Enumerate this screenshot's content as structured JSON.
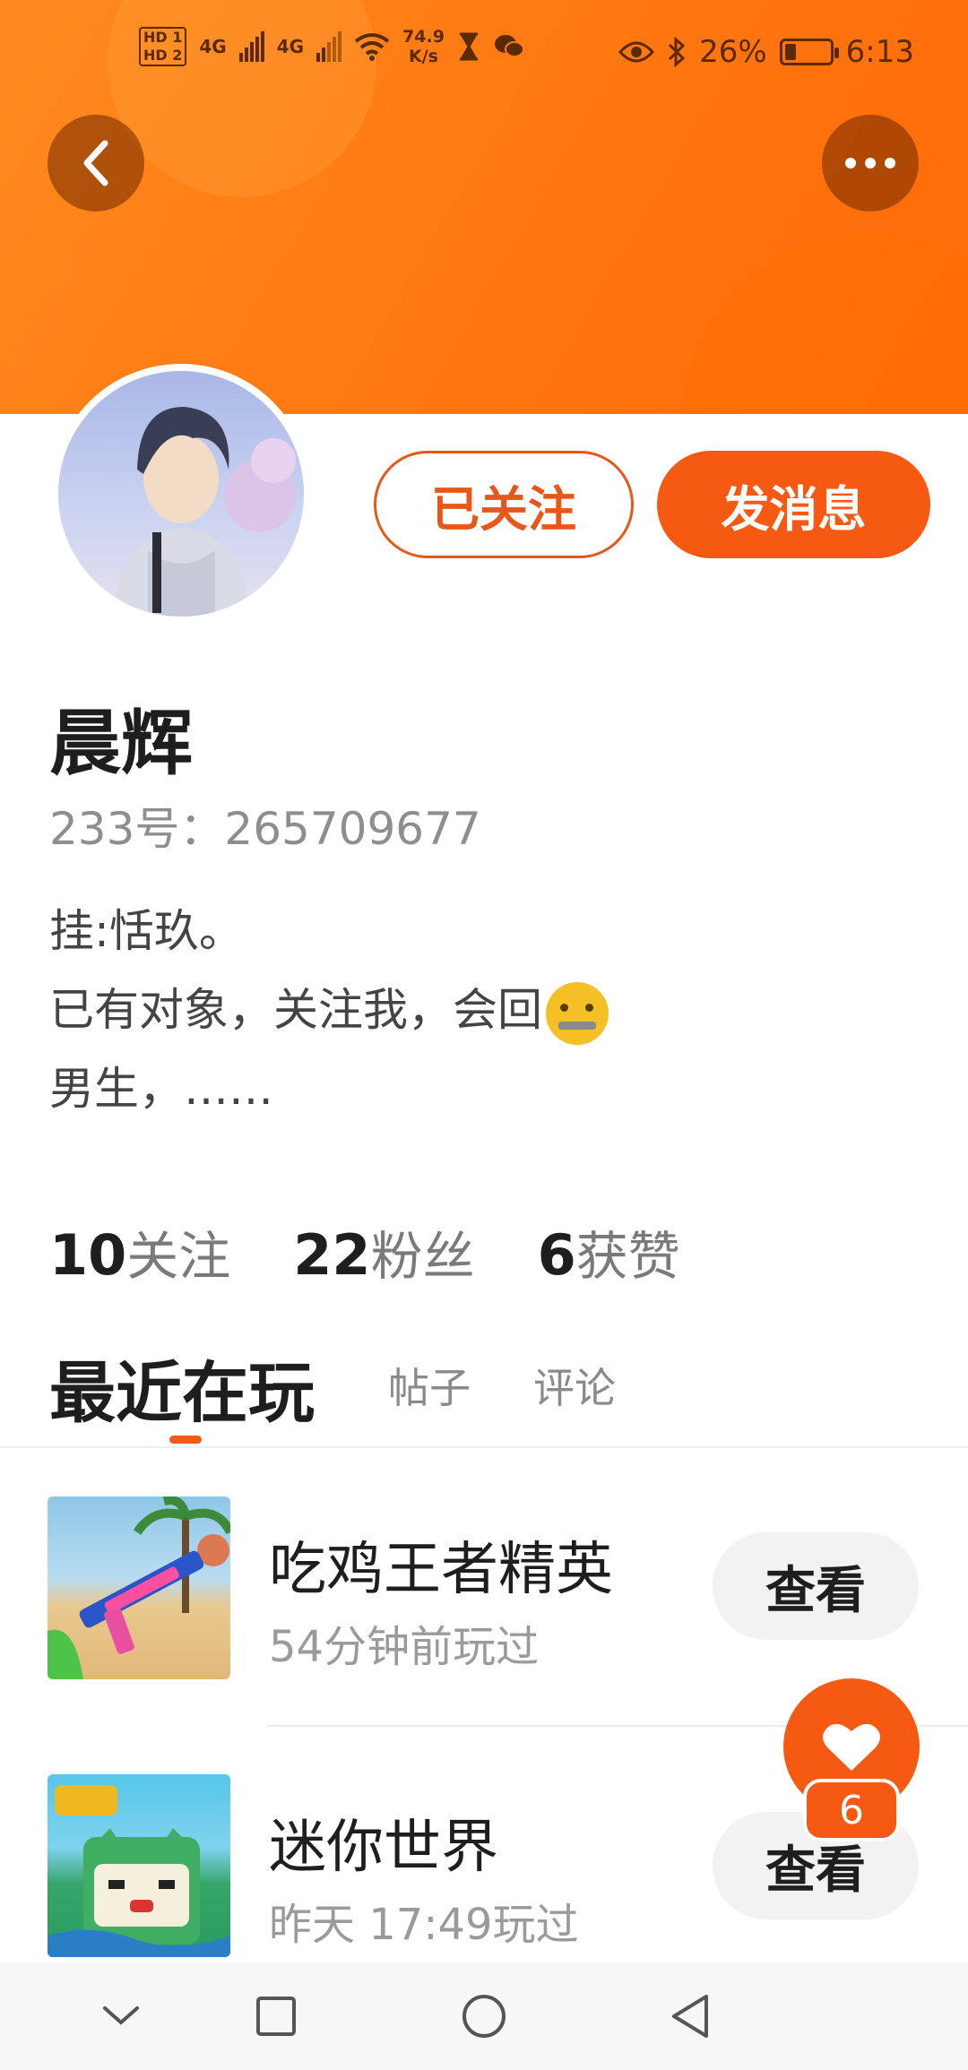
{
  "status_bar": {
    "hd1": "HD 1",
    "hd2": "HD 2",
    "net1": "4G",
    "net2": "4G",
    "speed_value": "74.9",
    "speed_unit": "K/s",
    "battery_percent": "26%",
    "battery_level": 0.26,
    "time": "6:13"
  },
  "header": {
    "back_icon": "chevron-left-icon",
    "more_icon": "more-dots-icon"
  },
  "profile": {
    "follow_label": "已关注",
    "message_label": "发消息",
    "name": "晨辉",
    "id_text": "233号：265709677",
    "bio_line1": "挂:恬玖。",
    "bio_line2": "已有对象，关注我，会回",
    "bio_line3": "男生，……"
  },
  "stats": {
    "following_count": "10",
    "following_label": "关注",
    "fans_count": "22",
    "fans_label": "粉丝",
    "likes_count": "6",
    "likes_label": "获赞"
  },
  "tabs": {
    "recent_play": "最近在玩",
    "posts": "帖子",
    "comments": "评论"
  },
  "games": [
    {
      "title": "吃鸡王者精英",
      "meta": "54分钟前玩过",
      "button": "查看"
    },
    {
      "title": "迷你世界",
      "meta": "昨天 17:49玩过",
      "button": "查看"
    }
  ],
  "like_fab": {
    "count": "6",
    "icon": "heart-icon"
  },
  "colors": {
    "accent": "#f65a12",
    "banner": "#ff7a12"
  }
}
